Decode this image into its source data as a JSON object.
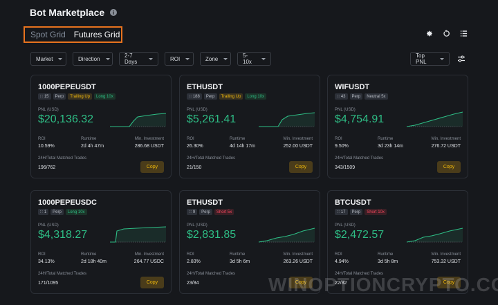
{
  "header": {
    "title": "Bot Marketplace"
  },
  "tabs": [
    {
      "label": "Spot Grid"
    },
    {
      "label": "Futures Grid"
    }
  ],
  "filters": [
    {
      "label": "Market",
      "width": 52
    },
    {
      "label": "Direction",
      "width": 58
    },
    {
      "label": "2-7 Days",
      "width": 57
    },
    {
      "label": "ROI",
      "width": 42
    },
    {
      "label": "Zone",
      "width": 45
    },
    {
      "label": "5-10x",
      "width": 49
    }
  ],
  "sort": {
    "label": "Top PNL"
  },
  "labels": {
    "pnl": "PNL (USD)",
    "roi": "ROI",
    "runtime": "Runtime",
    "min_investment": "Min. Investment",
    "trades": "24H/Total Matched Trades",
    "copy": "Copy"
  },
  "cards": [
    {
      "symbol": "1000PEPEUSDT",
      "copiers": "15",
      "tags": [
        {
          "text": "Perp",
          "tone": "gray"
        },
        {
          "text": "Trailing Up",
          "tone": "yellow"
        },
        {
          "text": "Long 10x",
          "tone": "green"
        }
      ],
      "pnl": "$20,136.32",
      "roi": "10.59%",
      "runtime": "2d 4h 47m",
      "min_investment": "286.68 USDT",
      "trades": "196/762"
    },
    {
      "symbol": "ETHUSDT",
      "copiers": "188",
      "tags": [
        {
          "text": "Perp",
          "tone": "gray"
        },
        {
          "text": "Trailing Up",
          "tone": "yellow"
        },
        {
          "text": "Long 10x",
          "tone": "green"
        }
      ],
      "pnl": "$5,261.41",
      "roi": "26.30%",
      "runtime": "4d 14h 17m",
      "min_investment": "252.00 USDT",
      "trades": "21/150"
    },
    {
      "symbol": "WIFUSDT",
      "copiers": "43",
      "tags": [
        {
          "text": "Perp",
          "tone": "gray"
        },
        {
          "text": "Neutral 5x",
          "tone": "gray"
        }
      ],
      "pnl": "$4,754.91",
      "roi": "9.50%",
      "runtime": "3d 23h 14m",
      "min_investment": "276.72 USDT",
      "trades": "343/1509"
    },
    {
      "symbol": "1000PEPEUSDC",
      "copiers": "1",
      "tags": [
        {
          "text": "Perp",
          "tone": "gray"
        },
        {
          "text": "Long 10x",
          "tone": "green"
        }
      ],
      "pnl": "$4,318.27",
      "roi": "34.13%",
      "runtime": "2d 18h 40m",
      "min_investment": "264.77 USDC",
      "trades": "171/1095"
    },
    {
      "symbol": "ETHUSDT",
      "copiers": "9",
      "tags": [
        {
          "text": "Perp",
          "tone": "gray"
        },
        {
          "text": "Short 5x",
          "tone": "red"
        }
      ],
      "pnl": "$2,831.85",
      "roi": "2.83%",
      "runtime": "3d 5h 6m",
      "min_investment": "263.26 USDT",
      "trades": "23/84"
    },
    {
      "symbol": "BTCUSDT",
      "copiers": "17",
      "tags": [
        {
          "text": "Perp",
          "tone": "gray"
        },
        {
          "text": "Short 10x",
          "tone": "red"
        }
      ],
      "pnl": "$2,472.57",
      "roi": "4.94%",
      "runtime": "3d 5h 8m",
      "min_investment": "753.32 USDT",
      "trades": "22/82"
    }
  ],
  "watermark": "WINOPTIONCRYPTO.COM"
}
